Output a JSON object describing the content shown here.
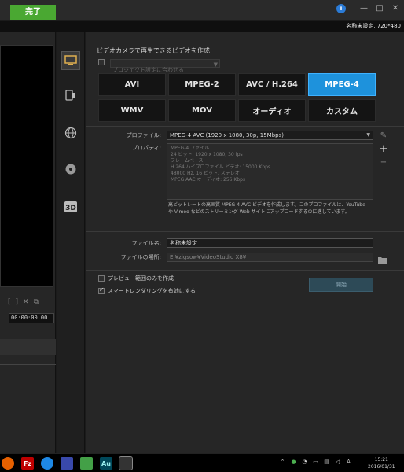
{
  "titlebar": {
    "finish_tab": "完了",
    "info": "i",
    "minimize": "—",
    "maximize": "□",
    "close": "✕"
  },
  "infostrip": {
    "text": "名称未設定, 720*480"
  },
  "preview": {
    "timecode": "00:00:00.00",
    "marker_in": "[",
    "marker_out": "]",
    "cut": "✕",
    "copy": "⧉"
  },
  "iconbar": {
    "items": [
      "computer-icon",
      "device-icon",
      "web-icon",
      "disc-icon",
      "3d-icon"
    ],
    "three_d": "3D"
  },
  "section": {
    "title": "ビデオカメラで再生できるビデオを作成",
    "match_project": "プロジェクト設定に合わせる"
  },
  "formats": [
    "AVI",
    "MPEG-2",
    "AVC / H.264",
    "MPEG-4",
    "WMV",
    "MOV",
    "オーディオ",
    "カスタム"
  ],
  "selected_format": "MPEG-4",
  "profile": {
    "label": "プロファイル:",
    "value": "MPEG-4 AVC (1920 x 1080, 30p, 15Mbps)",
    "props_label": "プロパティ:",
    "properties": [
      "MPEG-4 ファイル",
      "24 ビット, 1920 x 1080, 30 fps",
      "フレームベース",
      "H.264 ハイプロファイル ビデオ: 15000 Kbps",
      "48000 Hz, 16 ビット, ステレオ",
      "MPEG AAC オーディオ: 256 Kbps"
    ],
    "description_1": "高ビットレートの高画質 MPEG-4 AVC ビデオを作成します。このプロファイルは、YouTube",
    "description_2": "や Vimeo などのストリーミング Web サイトにアップロードするのに適しています。"
  },
  "file": {
    "name_label": "ファイル名:",
    "name_value": "名称未設定",
    "location_label": "ファイルの場所:",
    "location_value": "E:¥zigsow¥VideoStudio X8¥"
  },
  "options": {
    "preview_only": "プレビュー範囲のみを作成",
    "smart_render": "スマートレンダリングを有効にする"
  },
  "start_button": "開始",
  "taskbar": {
    "apps": [
      {
        "name": "firefox",
        "label": "",
        "color": "#e66000"
      },
      {
        "name": "filezilla",
        "label": "Fz",
        "color": "#bf0000"
      },
      {
        "name": "app3",
        "label": "",
        "color": "#1e88e5"
      },
      {
        "name": "app4",
        "label": "",
        "color": "#3949ab"
      },
      {
        "name": "app5",
        "label": "",
        "color": "#43a047"
      },
      {
        "name": "audition",
        "label": "Au",
        "color": "#00485a"
      },
      {
        "name": "videostudio",
        "label": "",
        "color": "#333333"
      }
    ],
    "time": "15:21",
    "date": "2016/01/31"
  }
}
